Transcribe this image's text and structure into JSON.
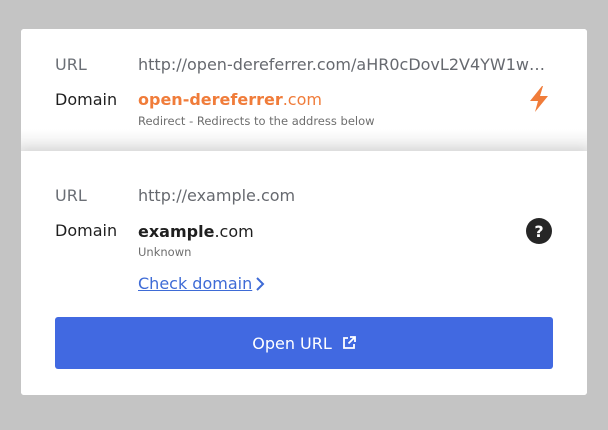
{
  "redirect": {
    "url_label": "URL",
    "url_value": "http://open-dereferrer.com/aHR0cDovL2V4YW1wb…",
    "domain_label": "Domain",
    "domain_name": "open-dereferrer",
    "domain_tld": ".com",
    "description": "Redirect - Redirects to the address below",
    "icon": "bolt-icon",
    "accent_color": "#f07c3a"
  },
  "target": {
    "url_label": "URL",
    "url_value": "http://example.com",
    "domain_label": "Domain",
    "domain_name": "example",
    "domain_tld": ".com",
    "status": "Unknown",
    "icon": "help-icon",
    "help_glyph": "?",
    "check_link": "Check domain",
    "link_color": "#3e6bd6"
  },
  "open_button": {
    "label": "Open URL",
    "icon": "external-link-icon",
    "color": "#4169e1"
  }
}
